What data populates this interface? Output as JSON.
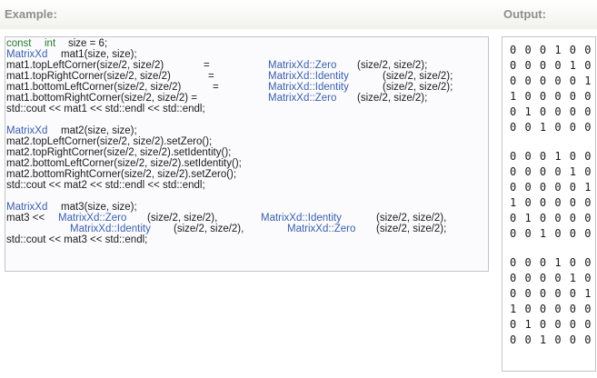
{
  "headers": {
    "example": "Example:",
    "output": "Output:"
  },
  "code": {
    "l1": {
      "a": "const",
      "b": "int",
      "c": "size = 6;"
    },
    "l2": {
      "a": "MatrixXd",
      "b": "mat1(size, size);"
    },
    "l3": {
      "a": "mat1.topLeftCorner(size/2, size/2)",
      "b": "=",
      "c": "MatrixXd::Zero",
      "d": "(size/2, size/2);"
    },
    "l4": {
      "a": "mat1.topRightCorner(size/2, size/2)",
      "b": "=",
      "c": "MatrixXd::Identity",
      "d": "(size/2, size/2);"
    },
    "l5": {
      "a": "mat1.bottomLeftCorner(size/2, size/2)",
      "b": "=",
      "c": "MatrixXd::Identity",
      "d": "(size/2, size/2);"
    },
    "l6": {
      "a": "mat1.bottomRightCorner(size/2, size/2) =",
      "c": "MatrixXd::Zero",
      "d": "(size/2, size/2);"
    },
    "l7": "std::cout << mat1 << std::endl << std::endl;",
    "l8": {
      "a": "MatrixXd",
      "b": "mat2(size, size);"
    },
    "l9": "mat2.topLeftCorner(size/2, size/2).setZero();",
    "l10": "mat2.topRightCorner(size/2, size/2).setIdentity();",
    "l11": "mat2.bottomLeftCorner(size/2, size/2).setIdentity();",
    "l12": "mat2.bottomRightCorner(size/2, size/2).setZero();",
    "l13": "std::cout << mat2 << std::endl << std::endl;",
    "l14": {
      "a": "MatrixXd",
      "b": "mat3(size, size);"
    },
    "l15": {
      "a": "mat3 <<",
      "b": "MatrixXd::Zero",
      "c": "(size/2, size/2),",
      "d": "MatrixXd::Identity",
      "e": "(size/2, size/2),"
    },
    "l16": {
      "b": "MatrixXd::Identity",
      "c": "(size/2, size/2),",
      "d": "MatrixXd::Zero",
      "e": "(size/2, size/2);"
    },
    "l17": "std::cout << mat3 << std::endl;"
  },
  "output": {
    "m1": [
      "0 0 0 1 0 0",
      "0 0 0 0 1 0",
      "0 0 0 0 0 1",
      "1 0 0 0 0 0",
      "0 1 0 0 0 0",
      "0 0 1 0 0 0"
    ],
    "m2": [
      "0 0 0 1 0 0",
      "0 0 0 0 1 0",
      "0 0 0 0 0 1",
      "1 0 0 0 0 0",
      "0 1 0 0 0 0",
      "0 0 1 0 0 0"
    ],
    "m3": [
      "0 0 0 1 0 0",
      "0 0 0 0 1 0",
      "0 0 0 0 0 1",
      "1 0 0 0 0 0",
      "0 1 0 0 0 0",
      "0 0 1 0 0 0"
    ]
  },
  "colors": {
    "keyword": "#2a7a2a",
    "type": "#3a5faa",
    "header_text": "#8f8f8f",
    "border": "#c4c4c4"
  }
}
